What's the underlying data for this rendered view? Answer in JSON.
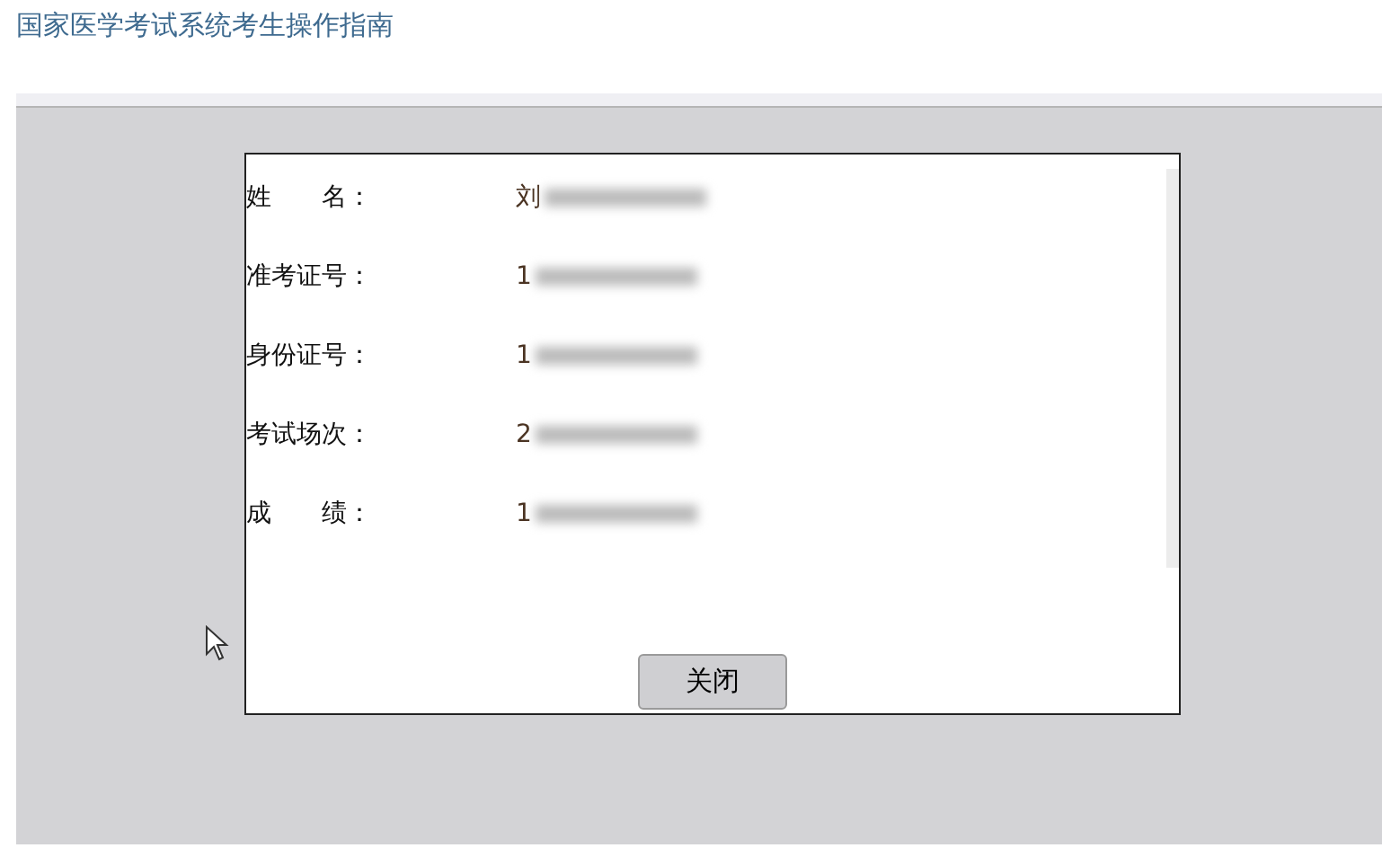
{
  "page_title": "国家医学考试系统考生操作指南",
  "dialog": {
    "fields": [
      {
        "label": "姓　　名：",
        "value": "刘"
      },
      {
        "label": "准考证号：",
        "value": "1"
      },
      {
        "label": "身份证号：",
        "value": "1"
      },
      {
        "label": "考试场次：",
        "value": "2"
      },
      {
        "label": "成　　绩：",
        "value": "1"
      }
    ],
    "close_button": "关闭"
  }
}
